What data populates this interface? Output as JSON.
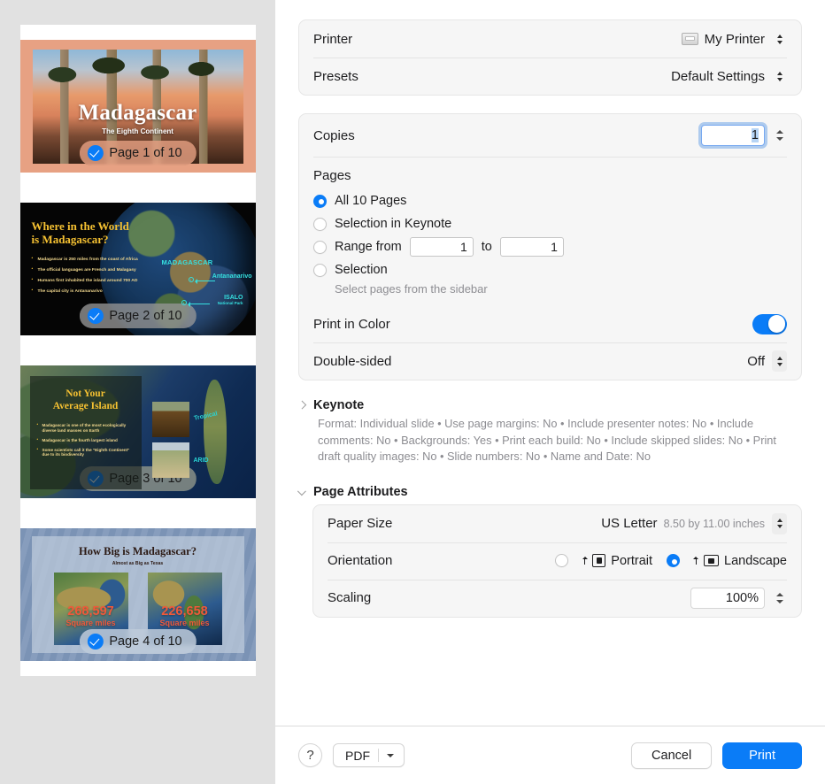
{
  "sidebar": {
    "slides": [
      {
        "badge": "Page 1 of 10",
        "title": "Madagascar",
        "subtitle": "The Eighth Continent"
      },
      {
        "badge": "Page 2 of 10",
        "title_line1": "Where in the World",
        "title_line2": "is Madagascar?",
        "bullets": [
          "Madagascar is 250 miles from the coast of Africa",
          "The official languages are French and Malagasy",
          "Humans first inhabited the island around 700 AD",
          "The capital city is Antananarivo"
        ],
        "map_labels": {
          "country": "MADAGASCAR",
          "capital": "Antananarivo",
          "park": "ISALO",
          "park_sub": "National Park"
        }
      },
      {
        "badge": "Page 3 of 10",
        "title_line1": "Not Your",
        "title_line2": "Average Island",
        "bullets": [
          "Madagascar is one of the most ecologically diverse land masses on Earth",
          "Madagascar is the fourth largest island",
          "Some scientists call it the \"Eighth Continent\" due to its biodiversity"
        ],
        "photo_labels": [
          "Tropical",
          "ARID"
        ]
      },
      {
        "badge": "Page 4 of 10",
        "title": "How Big is Madagascar?",
        "subtitle": "Almost as Big as Texas",
        "stats": [
          {
            "number": "268,597",
            "unit": "Square miles"
          },
          {
            "number": "226,658",
            "unit": "Square miles"
          }
        ]
      }
    ]
  },
  "printer_group": {
    "printer_label": "Printer",
    "printer_value": "My Printer",
    "presets_label": "Presets",
    "presets_value": "Default Settings"
  },
  "copies_group": {
    "copies_label": "Copies",
    "copies_value": "1",
    "pages_label": "Pages",
    "options": [
      {
        "label": "All 10 Pages",
        "selected": true
      },
      {
        "label": "Selection in Keynote",
        "selected": false
      },
      {
        "label": "Range from",
        "selected": false
      },
      {
        "label": "Selection",
        "selected": false
      }
    ],
    "range_from_value": "1",
    "range_to_label": "to",
    "range_to_value": "1",
    "selection_hint": "Select pages from the sidebar",
    "print_in_color_label": "Print in Color",
    "print_in_color_on": true,
    "double_sided_label": "Double-sided",
    "double_sided_value": "Off"
  },
  "keynote_section": {
    "title": "Keynote",
    "expanded": false,
    "summary": "Format: Individual slide • Use page margins: No • Include presenter notes: No • Include comments: No • Backgrounds: Yes • Print each build: No • Include skipped slides: No • Print draft quality images: No • Slide numbers: No • Name and Date: No"
  },
  "page_attributes": {
    "title": "Page Attributes",
    "expanded": true,
    "paper_size_label": "Paper Size",
    "paper_size_value": "US Letter",
    "paper_size_dimensions": "8.50 by 11.00 inches",
    "orientation_label": "Orientation",
    "orientation_portrait": "Portrait",
    "orientation_landscape": "Landscape",
    "orientation_selected": "Landscape",
    "scaling_label": "Scaling",
    "scaling_value": "100%"
  },
  "bottom_bar": {
    "help_label": "?",
    "pdf_label": "PDF",
    "cancel_label": "Cancel",
    "print_label": "Print"
  },
  "colors": {
    "accent_blue": "#0a7cf7",
    "sidebar_gray": "#e1e1e1",
    "group_bg": "#f6f6f6"
  }
}
